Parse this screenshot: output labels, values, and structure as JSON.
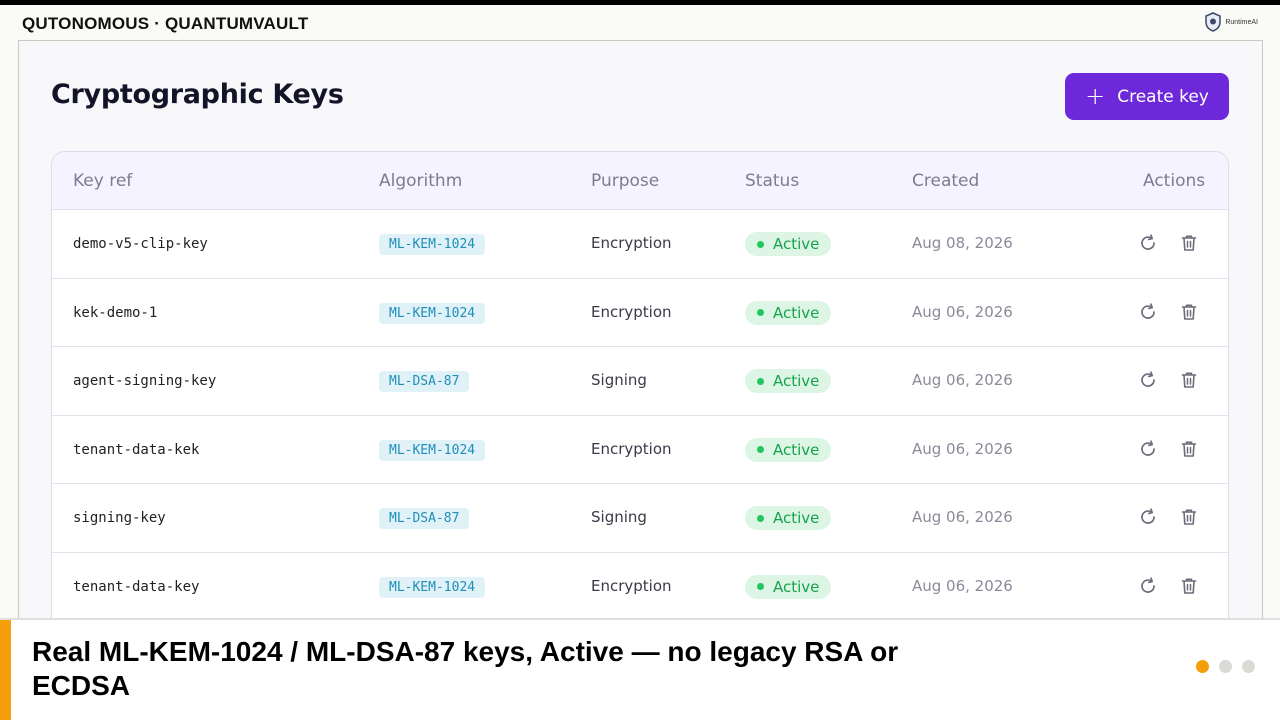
{
  "brand": "QUTONOMOUS · QUANTUMVAULT",
  "runtime_logo": {
    "label": "RuntimeAI",
    "icon": "shield-icon"
  },
  "page": {
    "title": "Cryptographic Keys"
  },
  "create_button": {
    "label": "Create key",
    "icon": "plus-icon"
  },
  "colors": {
    "accent": "#6d28d9",
    "active_green": "#16a34a",
    "algo_blue": "#1d8fb8",
    "caption_accent": "#f59e0b"
  },
  "table": {
    "columns": [
      "Key ref",
      "Algorithm",
      "Purpose",
      "Status",
      "Created",
      "Actions"
    ],
    "rows": [
      {
        "key_ref": "demo-v5-clip-key",
        "algorithm": "ML-KEM-1024",
        "purpose": "Encryption",
        "status": "Active",
        "created": "Aug 08, 2026"
      },
      {
        "key_ref": "kek-demo-1",
        "algorithm": "ML-KEM-1024",
        "purpose": "Encryption",
        "status": "Active",
        "created": "Aug 06, 2026"
      },
      {
        "key_ref": "agent-signing-key",
        "algorithm": "ML-DSA-87",
        "purpose": "Signing",
        "status": "Active",
        "created": "Aug 06, 2026"
      },
      {
        "key_ref": "tenant-data-kek",
        "algorithm": "ML-KEM-1024",
        "purpose": "Encryption",
        "status": "Active",
        "created": "Aug 06, 2026"
      },
      {
        "key_ref": "signing-key",
        "algorithm": "ML-DSA-87",
        "purpose": "Signing",
        "status": "Active",
        "created": "Aug 06, 2026"
      },
      {
        "key_ref": "tenant-data-key",
        "algorithm": "ML-KEM-1024",
        "purpose": "Encryption",
        "status": "Active",
        "created": "Aug 06, 2026"
      }
    ],
    "row_actions": [
      "rotate-icon",
      "trash-icon"
    ]
  },
  "caption": {
    "text": "Real ML-KEM-1024 / ML-DSA-87 keys, Active — no legacy RSA or ECDSA",
    "pager": {
      "total": 3,
      "current": 1
    }
  }
}
